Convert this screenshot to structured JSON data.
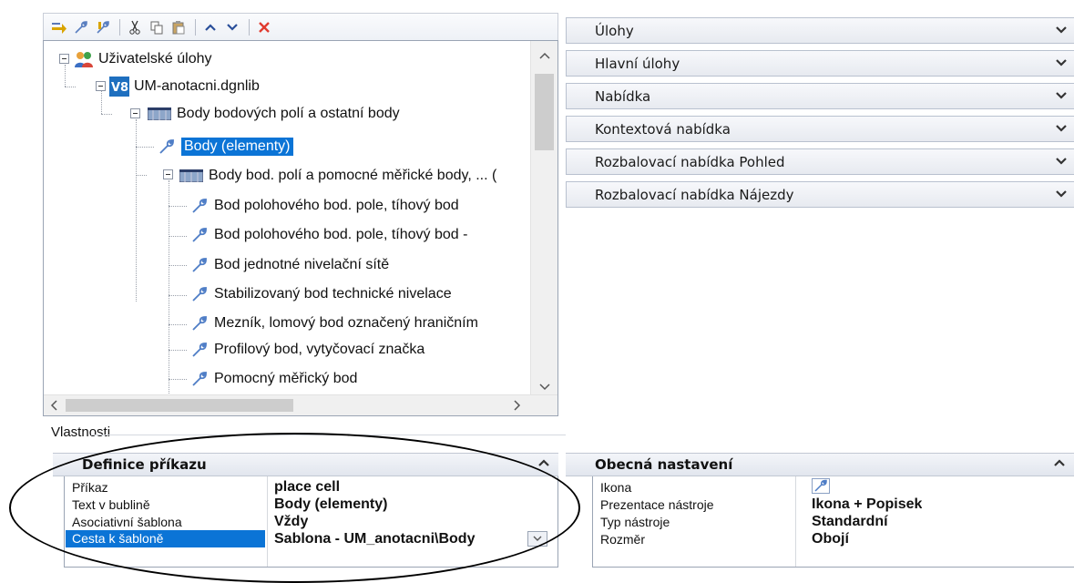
{
  "toolbar": {
    "buttons": [
      "add-item-icon",
      "tool-icon",
      "tool-edit-icon",
      "cut-icon",
      "copy-icon",
      "paste-icon",
      "move-up-icon",
      "move-down-icon",
      "delete-icon"
    ]
  },
  "tree": {
    "root": "Uživatelské úlohy",
    "library": "UM-anotacni.dgnlib",
    "group1": "Body bodových polí a ostatní body",
    "item_selected": "Body (elementy)",
    "group2": "Body bod. polí a pomocné měřické body, ... (",
    "items": [
      "Bod polohového bod. pole, tíhový bod",
      "Bod polohového bod. pole, tíhový bod -",
      "Bod jednotné nivelační sítě",
      "Stabilizovaný bod technické nivelace",
      "Mezník, lomový bod označený hraničním",
      "Profilový bod, vytyčovací značka",
      "Pomocný měřický bod"
    ]
  },
  "panels": [
    "Úlohy",
    "Hlavní úlohy",
    "Nabídka",
    "Kontextová nabídka",
    "Rozbalovací nabídka Pohled",
    "Rozbalovací nabídka Nájezdy"
  ],
  "properties": {
    "label": "Vlastnosti",
    "left": {
      "header": "Definice příkazu",
      "rows": [
        {
          "name": "Příkaz",
          "value": "place cell"
        },
        {
          "name": "Text v bublině",
          "value": "Body (elementy)"
        },
        {
          "name": "Asociativní šablona",
          "value": "Vždy"
        },
        {
          "name": "Cesta k šabloně",
          "value": "Sablona - UM_anotacni\\Body"
        }
      ]
    },
    "right": {
      "header": "Obecná nastavení",
      "rows": [
        {
          "name": "Ikona",
          "value": ""
        },
        {
          "name": "Prezentace nástroje",
          "value": "Ikona + Popisek"
        },
        {
          "name": "Typ nástroje",
          "value": "Standardní"
        },
        {
          "name": "Rozměr",
          "value": "Obojí"
        }
      ]
    }
  },
  "colors": {
    "selection": "#0b74d6",
    "delete_icon": "#e03b2f"
  }
}
